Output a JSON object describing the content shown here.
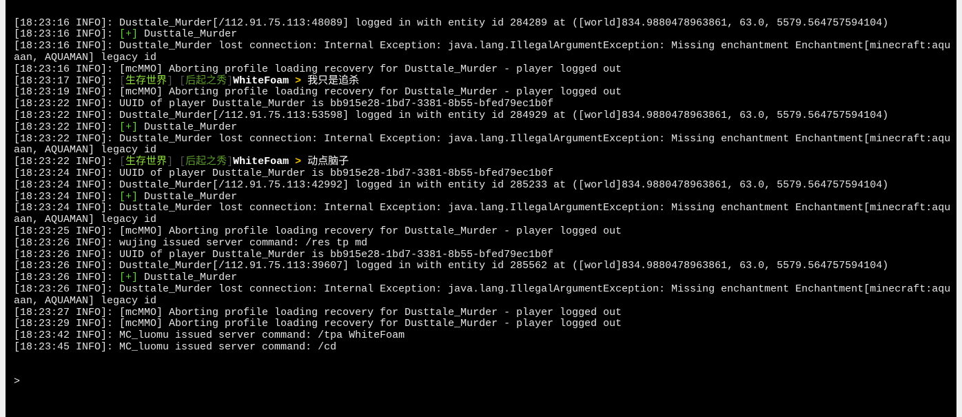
{
  "colors": {
    "default": "#e4e4e4",
    "green": "#5fd03a",
    "bracket": "#555555",
    "world": "#8fe03a",
    "title": "#5a9a2a",
    "name": "#ffffff",
    "arrow": "#f0c000",
    "chat": "#ffffff",
    "background": "#000000"
  },
  "lines": [
    [
      {
        "t": "[18:23:16 INFO]: Dusttale_Murder[/112.91.75.113:48089] logged in with entity id 284289 at ([world]834.9880478963861, 63.0, 5579.564757594104)"
      }
    ],
    [
      {
        "t": "[18:23:16 INFO]: "
      },
      {
        "t": "[+]",
        "c": "green"
      },
      {
        "t": " Dusttale_Murder"
      }
    ],
    [
      {
        "t": "[18:23:16 INFO]: Dusttale_Murder lost connection: Internal Exception: java.lang.IllegalArgumentException: Missing enchantment Enchantment[minecraft:aquaan, AQUAMAN] legacy id"
      }
    ],
    [
      {
        "t": "[18:23:16 INFO]: [mcMMO] Aborting profile loading recovery for Dusttale_Murder - player logged out"
      }
    ],
    [
      {
        "t": "[18:23:17 INFO]: "
      },
      {
        "t": "[",
        "c": "bracket"
      },
      {
        "t": "生存世界",
        "c": "world"
      },
      {
        "t": "] [",
        "c": "bracket"
      },
      {
        "t": "后起之秀",
        "c": "title"
      },
      {
        "t": "]",
        "c": "bracket"
      },
      {
        "t": "WhiteFoam",
        "c": "name",
        "b": true
      },
      {
        "t": " > ",
        "c": "arrow",
        "b": true
      },
      {
        "t": "我只是追杀",
        "c": "chat"
      }
    ],
    [
      {
        "t": "[18:23:19 INFO]: [mcMMO] Aborting profile loading recovery for Dusttale_Murder - player logged out"
      }
    ],
    [
      {
        "t": "[18:23:22 INFO]: UUID of player Dusttale_Murder is bb915e28-1bd7-3381-8b55-bfed79ec1b0f"
      }
    ],
    [
      {
        "t": "[18:23:22 INFO]: Dusttale_Murder[/112.91.75.113:53598] logged in with entity id 284929 at ([world]834.9880478963861, 63.0, 5579.564757594104)"
      }
    ],
    [
      {
        "t": "[18:23:22 INFO]: "
      },
      {
        "t": "[+]",
        "c": "green"
      },
      {
        "t": " Dusttale_Murder"
      }
    ],
    [
      {
        "t": "[18:23:22 INFO]: Dusttale_Murder lost connection: Internal Exception: java.lang.IllegalArgumentException: Missing enchantment Enchantment[minecraft:aquaan, AQUAMAN] legacy id"
      }
    ],
    [
      {
        "t": "[18:23:22 INFO]: "
      },
      {
        "t": "[",
        "c": "bracket"
      },
      {
        "t": "生存世界",
        "c": "world"
      },
      {
        "t": "] [",
        "c": "bracket"
      },
      {
        "t": "后起之秀",
        "c": "title"
      },
      {
        "t": "]",
        "c": "bracket"
      },
      {
        "t": "WhiteFoam",
        "c": "name",
        "b": true
      },
      {
        "t": " > ",
        "c": "arrow",
        "b": true
      },
      {
        "t": "动点脑子",
        "c": "chat"
      }
    ],
    [
      {
        "t": "[18:23:24 INFO]: UUID of player Dusttale_Murder is bb915e28-1bd7-3381-8b55-bfed79ec1b0f"
      }
    ],
    [
      {
        "t": "[18:23:24 INFO]: Dusttale_Murder[/112.91.75.113:42992] logged in with entity id 285233 at ([world]834.9880478963861, 63.0, 5579.564757594104)"
      }
    ],
    [
      {
        "t": "[18:23:24 INFO]: "
      },
      {
        "t": "[+]",
        "c": "green"
      },
      {
        "t": " Dusttale_Murder"
      }
    ],
    [
      {
        "t": "[18:23:24 INFO]: Dusttale_Murder lost connection: Internal Exception: java.lang.IllegalArgumentException: Missing enchantment Enchantment[minecraft:aquaan, AQUAMAN] legacy id"
      }
    ],
    [
      {
        "t": "[18:23:25 INFO]: [mcMMO] Aborting profile loading recovery for Dusttale_Murder - player logged out"
      }
    ],
    [
      {
        "t": "[18:23:26 INFO]: wujing issued server command: /res tp md"
      }
    ],
    [
      {
        "t": "[18:23:26 INFO]: UUID of player Dusttale_Murder is bb915e28-1bd7-3381-8b55-bfed79ec1b0f"
      }
    ],
    [
      {
        "t": "[18:23:26 INFO]: Dusttale_Murder[/112.91.75.113:39607] logged in with entity id 285562 at ([world]834.9880478963861, 63.0, 5579.564757594104)"
      }
    ],
    [
      {
        "t": "[18:23:26 INFO]: "
      },
      {
        "t": "[+]",
        "c": "green"
      },
      {
        "t": " Dusttale_Murder"
      }
    ],
    [
      {
        "t": "[18:23:26 INFO]: Dusttale_Murder lost connection: Internal Exception: java.lang.IllegalArgumentException: Missing enchantment Enchantment[minecraft:aquaan, AQUAMAN] legacy id"
      }
    ],
    [
      {
        "t": "[18:23:27 INFO]: [mcMMO] Aborting profile loading recovery for Dusttale_Murder - player logged out"
      }
    ],
    [
      {
        "t": "[18:23:29 INFO]: [mcMMO] Aborting profile loading recovery for Dusttale_Murder - player logged out"
      }
    ],
    [
      {
        "t": "[18:23:42 INFO]: MC_luomu issued server command: /tpa WhiteFoam"
      }
    ],
    [
      {
        "t": "[18:23:45 INFO]: MC_luomu issued server command: /cd"
      }
    ]
  ],
  "prompt": ">"
}
